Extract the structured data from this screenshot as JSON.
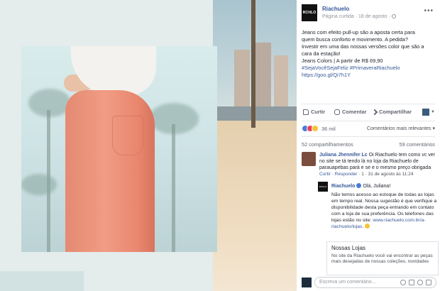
{
  "post": {
    "page_avatar_text": "RCHLO",
    "page_name": "Riachuelo",
    "meta": "Página curtida · 18 de agosto ·",
    "text_lines": [
      "Jeans com efeito pull-up são a aposta certa para",
      "quem busca conforto e movimento. A pedida?",
      "Investir em uma das nossas versões color que são a",
      "cara da estação!",
      "Jeans Colors | A partir de R$ 69,90"
    ],
    "hashtags": "#SejaVocêSejaFeliz #PrimaveraRiachuelo",
    "link": "https://goo.gl/Qi7h1Y"
  },
  "actions": {
    "like": "Curtir",
    "comment": "Comentar",
    "share": "Compartilhar"
  },
  "reactions": {
    "count": "36 mil",
    "sort_label": "Comentários mais relevantes ▾"
  },
  "stats": {
    "shares": "52 compartilhamentos",
    "comments": "59 comentários"
  },
  "comment1": {
    "name": "Juliana Jhennifer Lc",
    "text": "Oi Riachuelo tem como vc ver no site se tá tendo lá no loja da Riachuelo de parauapebas pará e se e o mesmo preço obrigada",
    "links_curtir": "Curtir",
    "links_responder": "Responder",
    "links_meta": "· 1 · 31 de agosto às 11:24"
  },
  "reply": {
    "avatar_text": "RCHLO",
    "name": "Riachuelo",
    "greeting": "Olá, Juliana!",
    "text": "Não temos acesso ao estoque de todas as lojas em tempo real. Nossa sugestão é que verifique a disponibilidade desta peça entrando em contato com a loja de sua preferência. Os telefones das lojas estão no site:",
    "link": "www.riachuelo.com.br/a-riachuelo/lojas."
  },
  "link_card": {
    "title": "Nossas Lojas",
    "desc": "No site da Riachuelo você vai encontrar as peças mais desejadas de nossas coleções, novidades"
  },
  "composer": {
    "placeholder": "Escreva um comentário..."
  }
}
